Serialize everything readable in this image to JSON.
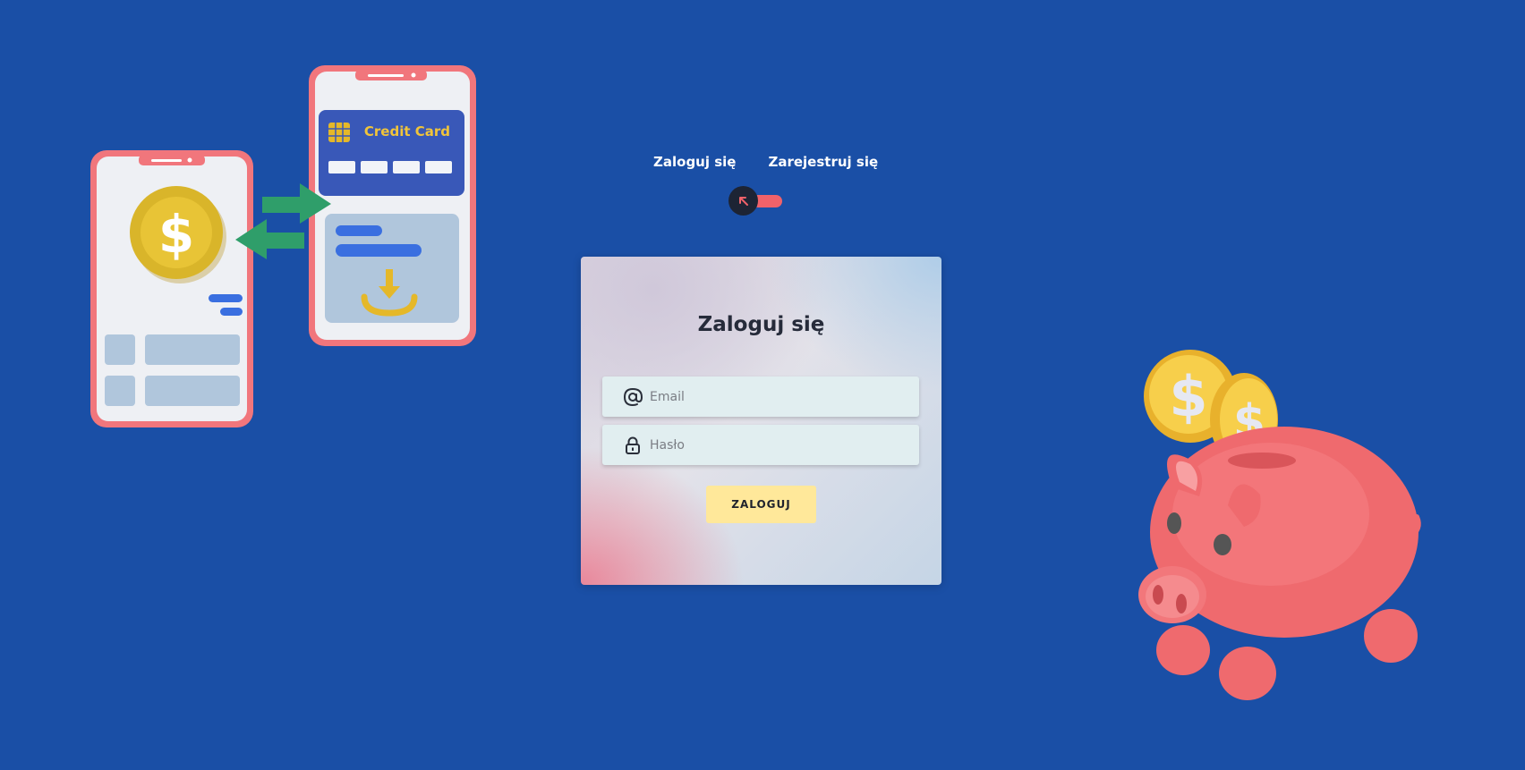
{
  "toggle": {
    "login_label": "Zaloguj się",
    "register_label": "Zarejestruj się"
  },
  "login_card": {
    "title": "Zaloguj się",
    "email_placeholder": "Email",
    "password_placeholder": "Hasło",
    "submit_label": "ZALOGUJ"
  },
  "illustrations": {
    "credit_card_text": "Credit Card",
    "coin_symbol": "$"
  },
  "colors": {
    "background": "#1a4fa6",
    "accent_pink": "#f0626a",
    "button_yellow": "#ffe89a",
    "knob_dark": "#1d2434"
  }
}
